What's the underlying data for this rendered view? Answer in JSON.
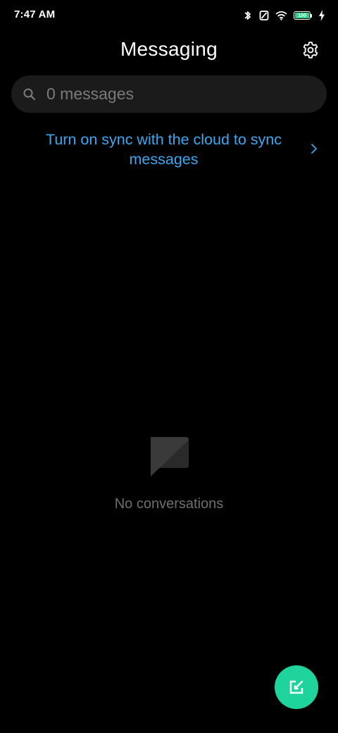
{
  "status_bar": {
    "time": "7:47 AM",
    "battery_level": "100",
    "icons": [
      "bluetooth-icon",
      "no-sim-icon",
      "wifi-icon",
      "battery-icon",
      "charging-icon"
    ]
  },
  "header": {
    "title": "Messaging",
    "settings_icon": "gear-icon"
  },
  "search": {
    "placeholder": "0 messages",
    "value": "",
    "icon": "search-icon"
  },
  "sync_banner": {
    "text": "Turn on sync with the cloud to sync messages",
    "icon": "chevron-right-icon"
  },
  "empty_state": {
    "icon": "chat-bubble-icon",
    "text": "No conversations"
  },
  "fab": {
    "icon": "compose-icon"
  },
  "colors": {
    "background": "#000000",
    "search_bg": "#1b1b1b",
    "link": "#3aa7f0",
    "muted_text": "#6e6e6e",
    "fab": "#1ed39c",
    "battery_fill": "#2fd18c"
  }
}
